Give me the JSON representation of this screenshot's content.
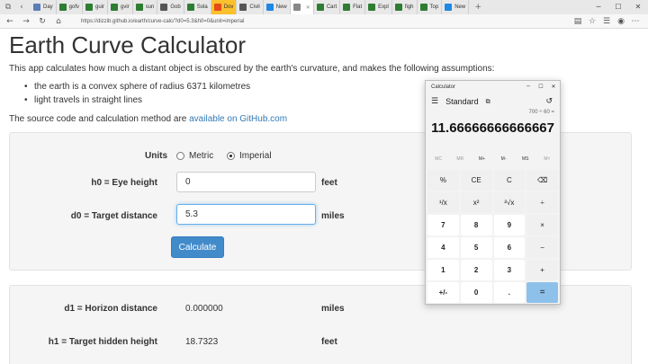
{
  "browser": {
    "tabs": [
      {
        "label": "Day",
        "color": "#5b7db8"
      },
      {
        "label": "gofv",
        "color": "#2e7d32"
      },
      {
        "label": "guir",
        "color": "#2e7d32"
      },
      {
        "label": "gvir",
        "color": "#2e7d32"
      },
      {
        "label": "sun",
        "color": "#2e7d32"
      },
      {
        "label": "Gob",
        "color": "#555555"
      },
      {
        "label": "Sola",
        "color": "#2e7d32"
      },
      {
        "label": "Dov",
        "color": "#e64a19",
        "highlight": true
      },
      {
        "label": "Civil",
        "color": "#555555"
      },
      {
        "label": "New",
        "color": "#1e88e5"
      },
      {
        "label": "",
        "color": "#888888",
        "active": true
      },
      {
        "label": "Cart",
        "color": "#2e7d32"
      },
      {
        "label": "Flat",
        "color": "#2e7d32"
      },
      {
        "label": "Expl",
        "color": "#2e7d32"
      },
      {
        "label": "figh",
        "color": "#2e7d32"
      },
      {
        "label": "Top",
        "color": "#2e7d32"
      },
      {
        "label": "New",
        "color": "#1e88e5"
      }
    ],
    "url": "https://dizzib.github.io/earth/curve-calc/?d0=5.3&h0=0&unit=imperial"
  },
  "page": {
    "title": "Earth Curve Calculator",
    "intro": "This app calculates how much a distant object is obscured by the earth's curvature, and makes the following assumptions:",
    "bullets": [
      "the earth is a convex sphere of radius 6371 kilometres",
      "light travels in straight lines"
    ],
    "source_text": "The source code and calculation method are ",
    "source_link": "available on GitHub.com"
  },
  "form": {
    "units_label": "Units",
    "metric_label": "Metric",
    "imperial_label": "Imperial",
    "selected_unit": "imperial",
    "h0_label": "h0 = Eye height",
    "h0_value": "0",
    "h0_unit": "feet",
    "d0_label": "d0 = Target distance",
    "d0_value": "5.3",
    "d0_unit": "miles",
    "calculate_label": "Calculate"
  },
  "results": {
    "d1_label": "d1 = Horizon distance",
    "d1_value": "0.000000",
    "d1_unit": "miles",
    "h1_label": "h1 = Target hidden height",
    "h1_value": "18.7323",
    "h1_unit": "feet"
  },
  "calculator": {
    "title": "Calculator",
    "mode": "Standard",
    "expression": "700 ÷ 60 =",
    "display": "11.66666666666667",
    "memory": [
      "MC",
      "MR",
      "M+",
      "M-",
      "MS",
      "M˅"
    ],
    "keys": [
      "%",
      "CE",
      "C",
      "⌫",
      "¹/x",
      "x²",
      "²√x",
      "÷",
      "7",
      "8",
      "9",
      "×",
      "4",
      "5",
      "6",
      "−",
      "1",
      "2",
      "3",
      "+",
      "+/-",
      "0",
      ".",
      "="
    ]
  }
}
